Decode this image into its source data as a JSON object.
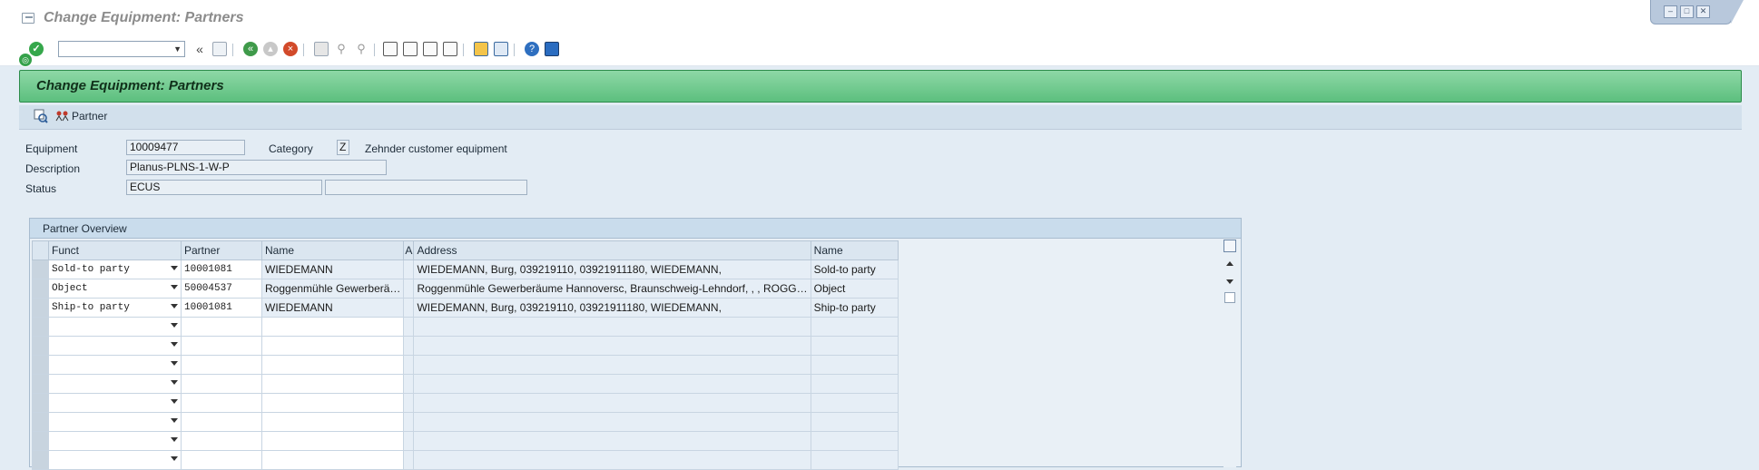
{
  "window": {
    "title": "Change Equipment: Partners",
    "controls": [
      "minimize",
      "maximize",
      "close"
    ]
  },
  "toolbar": {
    "command_field_value": "",
    "icons": [
      "enter-icon",
      "back-double-arrow-icon",
      "save-icon",
      "back-icon",
      "exit-icon",
      "cancel-icon",
      "print-icon",
      "find-icon",
      "find-next-icon",
      "first-page-icon",
      "previous-page-icon",
      "next-page-icon",
      "last-page-icon",
      "create-session-icon",
      "shortcut-icon",
      "help-icon",
      "customize-layout-icon"
    ]
  },
  "screen": {
    "title": "Change Equipment: Partners",
    "app_toolbar": {
      "partner_label": "Partner"
    }
  },
  "header": {
    "equipment_label": "Equipment",
    "equipment_value": "10009477",
    "category_label": "Category",
    "category_value": "Z",
    "category_text": "Zehnder customer equipment",
    "description_label": "Description",
    "description_value": "Planus-PLNS-1-W-P",
    "status_label": "Status",
    "status_value": "ECUS",
    "status_value2": ""
  },
  "partner_overview": {
    "title": "Partner Overview",
    "columns": [
      "Funct",
      "Partner",
      "Name",
      "A",
      "Address",
      "Name"
    ],
    "rows": [
      {
        "funct": "Sold-to party",
        "partner": "10001081",
        "name": "WIEDEMANN",
        "a": "",
        "address": "WIEDEMANN, Burg, 039219110, 03921911180, WIEDEMANN,",
        "name2": "Sold-to party"
      },
      {
        "funct": "Object",
        "partner": "50004537",
        "name": "Roggenmühle Gewerberä…",
        "a": "",
        "address": "Roggenmühle Gewerberäume Hannoversc, Braunschweig-Lehndorf, , , ROGG…",
        "name2": "Object"
      },
      {
        "funct": "Ship-to party",
        "partner": "10001081",
        "name": "WIEDEMANN",
        "a": "",
        "address": "WIEDEMANN, Burg, 039219110, 03921911180, WIEDEMANN,",
        "name2": "Ship-to party"
      }
    ],
    "empty_rows": 8
  },
  "colors": {
    "header_green": "#5cbf7e",
    "background": "#e3ecf4",
    "accent_blue": "#c9dcec"
  }
}
